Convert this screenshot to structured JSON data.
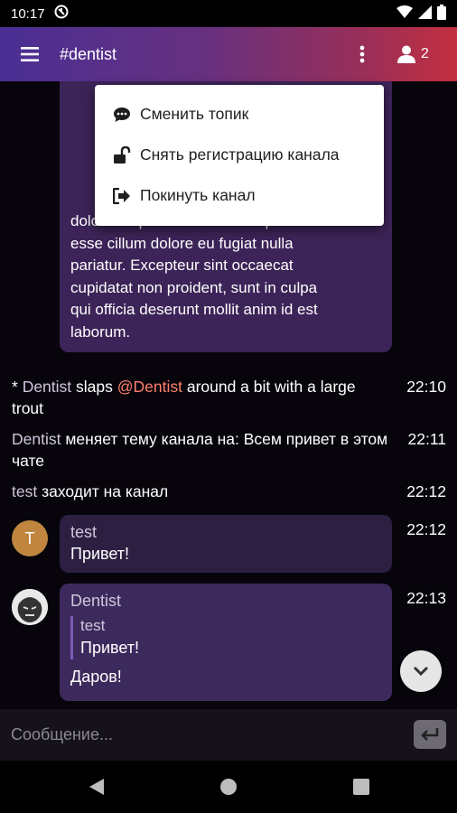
{
  "status_bar": {
    "time": "10:17"
  },
  "app_bar": {
    "channel": "#dentist",
    "user_count": "2"
  },
  "menu": {
    "items": [
      {
        "label": "Сменить топик",
        "icon": "speech-bubble-icon"
      },
      {
        "label": "Снять регистрацию канала",
        "icon": "unlock-icon"
      },
      {
        "label": "Покинуть канал",
        "icon": "exit-icon"
      }
    ]
  },
  "chat": {
    "long_message_lines": [
      "dolor in reprehenderit in voluptate velit",
      "esse cillum dolore eu fugiat nulla",
      "pariatur. Excepteur sint occaecat",
      "cupidatat non proident, sunt in culpa",
      "qui officia deserunt mollit anim id est",
      "laborum."
    ],
    "action": {
      "prefix": "* ",
      "nick": "Dentist",
      "text1": " slaps ",
      "mention": "@Dentist",
      "text2": " around a bit with a large trout",
      "time": "22:10"
    },
    "topic_change": {
      "nick": "Dentist",
      "text": " меняет тему канала на: Всем привет в этом чате",
      "time": "22:11"
    },
    "join": {
      "nick": "test",
      "text": " заходит на канал",
      "time": "22:12"
    },
    "msg1": {
      "avatar_letter": "T",
      "author": "test",
      "text": "Привет!",
      "time": "22:12"
    },
    "msg2": {
      "author": "Dentist",
      "quote_author": "test",
      "quote_text": "Привет!",
      "text": "Даров!",
      "time": "22:13"
    }
  },
  "input": {
    "placeholder": "Сообщение..."
  },
  "colors": {
    "accent_mention": "#ff7f6e",
    "bubble": "#3d2458",
    "appbar_start": "#4a2f94",
    "appbar_end": "#c22f3e"
  }
}
